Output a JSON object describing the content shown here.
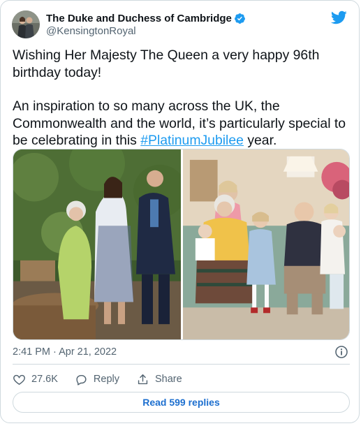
{
  "author": {
    "name": "The Duke and Duchess of Cambridge",
    "handle": "@KensingtonRoyal"
  },
  "tweet": {
    "line1": "Wishing Her Majesty The Queen a very happy 96th birthday today!",
    "line2_before": "An inspiration to so many across the UK, the Commonwealth and the world, it’s particularly special to be celebrating in this ",
    "hashtag": "#PlatinumJubilee",
    "line2_after": " year."
  },
  "meta": {
    "timestamp": "2:41 PM · Apr 21, 2022"
  },
  "actions": {
    "likes": "27.6K",
    "reply_label": "Reply",
    "share_label": "Share"
  },
  "replies_button": "Read 599 replies",
  "colors": {
    "accent": "#1d9bf0",
    "link": "#1d6fcf",
    "muted": "#536471",
    "border": "#cfd9de"
  },
  "icons": [
    "verified-badge-icon",
    "twitter-bird-icon",
    "info-icon",
    "heart-icon",
    "reply-bubble-icon",
    "share-icon"
  ]
}
